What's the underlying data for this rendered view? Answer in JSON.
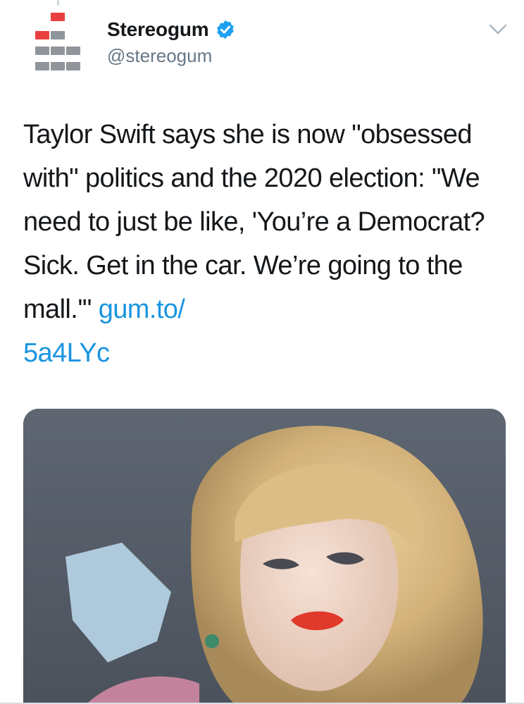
{
  "tweet": {
    "account": {
      "display_name": "Stereogum",
      "handle": "@stereogum",
      "verified": true,
      "avatar_icon": "stereogum-logo-icon",
      "avatar_colors": {
        "accent": "#e8403f",
        "gray": "#8f959b"
      }
    },
    "menu_icon": "chevron-down-icon",
    "text_main": "Taylor Swift says she is now \"obsessed with\" politics and the 2020 election: \"We need to just be like, 'You’re a Democrat? Sick. Get in the car. We’re going to the mall.'\" ",
    "link_text_1": "gum.to/",
    "link_text_2": "5a4LYc",
    "colors": {
      "link": "#1b95e0",
      "verified_badge": "#1da1f2",
      "text": "#14171a",
      "secondary": "#657786"
    }
  }
}
